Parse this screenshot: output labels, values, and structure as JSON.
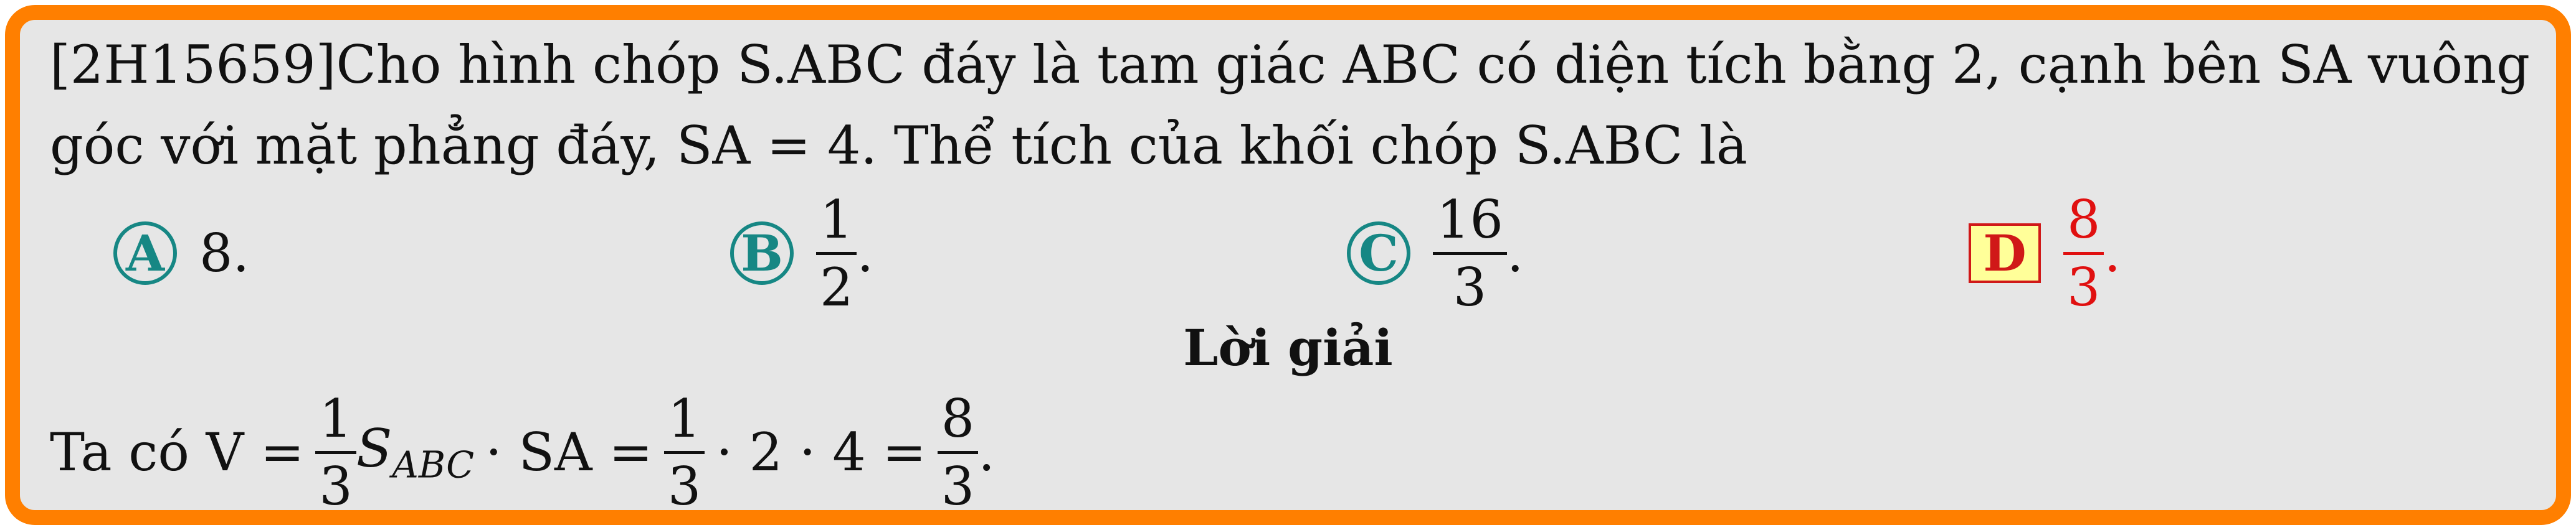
{
  "question": {
    "line1": "[2H15659]Cho hình chóp S.ABC đáy là tam giác ABC có diện tích bằng 2, cạnh bên SA vuông",
    "line2": "góc với mặt phẳng đáy, SA = 4. Thể tích của khối chóp S.ABC là"
  },
  "choices": [
    {
      "letter": "A",
      "text": "8."
    },
    {
      "letter": "B",
      "numerator": "1",
      "denominator": "2",
      "suffix": "."
    },
    {
      "letter": "C",
      "numerator": "16",
      "denominator": "3",
      "suffix": "."
    },
    {
      "letter": "D",
      "numerator": "8",
      "denominator": "3",
      "suffix": ".",
      "correct": true
    }
  ],
  "solution": {
    "title": "Lời giải",
    "prefix": "Ta có V =",
    "f1_num": "1",
    "f1_den": "3",
    "s_main": "S",
    "s_sub": "ABC",
    "mid": "· SA =",
    "f2_num": "1",
    "f2_den": "3",
    "calc": "· 2 · 4 =",
    "f3_num": "8",
    "f3_den": "3",
    "end": "."
  },
  "colors": {
    "border": "#ff7f00",
    "background": "#e6e6e6",
    "choice_circle": "#168784",
    "correct": "#e01010",
    "correct_box_fill": "#ffff99"
  }
}
